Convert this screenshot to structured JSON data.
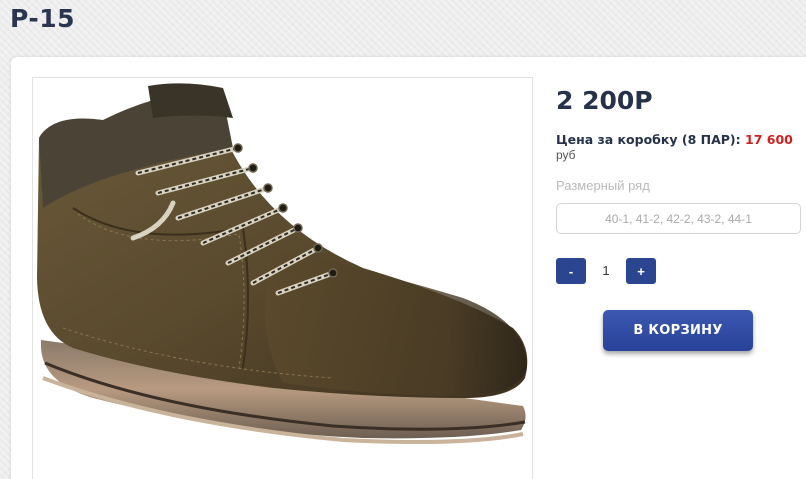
{
  "product": {
    "title": "P-15",
    "price": "2 200P",
    "box_price_label": "Цена за коробку (8 ПАР):",
    "box_price_value": "17 600",
    "currency": "руб",
    "image_alt": "brown leather lace-up boot"
  },
  "size_range": {
    "label": "Размерный ряд",
    "value": "40-1, 41-2, 42-2, 43-2, 44-1"
  },
  "quantity": {
    "minus_label": "-",
    "value": "1",
    "plus_label": "+"
  },
  "actions": {
    "add_to_cart_label": "В КОРЗИНУ"
  },
  "colors": {
    "accent": "#2b4590",
    "title_text": "#26314a",
    "price_highlight": "#d01f1f"
  }
}
